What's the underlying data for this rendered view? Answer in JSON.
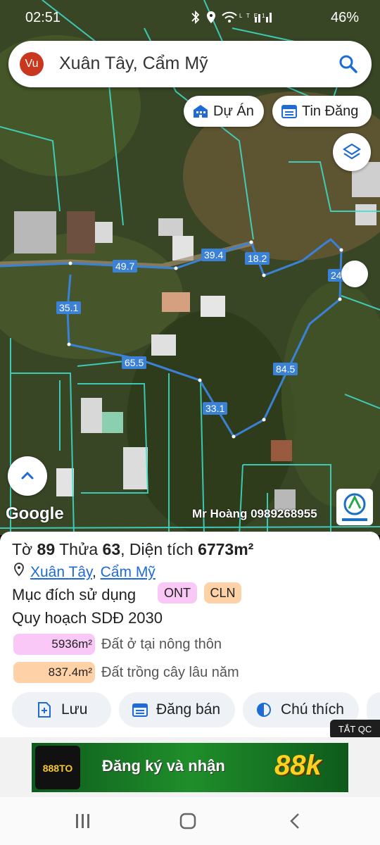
{
  "status_bar": {
    "time": "02:51",
    "battery": "46%"
  },
  "search": {
    "avatar_text": "Vu",
    "query": "Xuân Tây, Cẩm Mỹ"
  },
  "chips": {
    "du_an": "Dự Án",
    "tin_dang": "Tin Đăng"
  },
  "map": {
    "google_label": "Google",
    "watermark": "Mr Hoàng 0989268955",
    "dimensions": [
      "49.7",
      "39.4",
      "18.2",
      "24",
      "35.1",
      "65.5",
      "33.1",
      "84.5"
    ],
    "boundary_color": "#3b82d6"
  },
  "parcel": {
    "to_label": "Tờ",
    "to_number": "89",
    "thua_label": "Thửa",
    "thua_number": "63",
    "area_label": "Diện tích",
    "area_value": "6773m²",
    "location_commune": "Xuân Tây",
    "location_separator": ",",
    "location_district": "Cẩm Mỹ",
    "purpose_label": "Mục đích sử dụng",
    "badges": [
      "ONT",
      "CLN"
    ],
    "planning_label": "Quy hoạch SDĐ 2030",
    "areas": [
      {
        "value": "5936m²",
        "desc": "Đất ở tại nông thôn",
        "color": "#f9c8f6"
      },
      {
        "value": "837.4m²",
        "desc": "Đất trồng cây lâu năm",
        "color": "#ffd1a6"
      }
    ]
  },
  "actions": {
    "save": "Lưu",
    "sell": "Đăng bán",
    "legend": "Chú thích"
  },
  "hide_ads": "TẮT QC",
  "ad": {
    "brand": "888TO",
    "text": "Đăng ký và nhận",
    "amount": "88k"
  }
}
